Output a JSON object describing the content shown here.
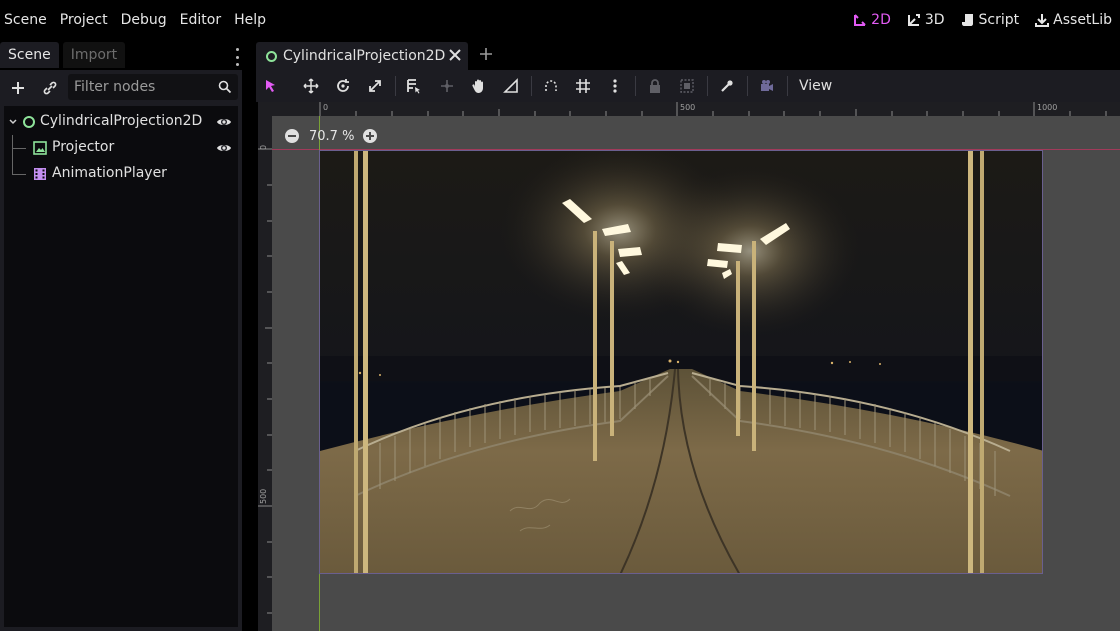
{
  "menu": [
    "Scene",
    "Project",
    "Debug",
    "Editor",
    "Help"
  ],
  "main_screens": [
    {
      "label": "2D",
      "icon": "2d-icon",
      "active": true
    },
    {
      "label": "3D",
      "icon": "3d-icon",
      "active": false
    },
    {
      "label": "Script",
      "icon": "script-icon",
      "active": false
    },
    {
      "label": "AssetLib",
      "icon": "assetlib-icon",
      "active": false
    }
  ],
  "dock": {
    "tabs": [
      "Scene",
      "Import"
    ],
    "filter_placeholder": "Filter nodes",
    "tree": [
      {
        "label": "CylindricalProjection2D",
        "icon": "node2d-icon",
        "visible_toggle": true
      },
      {
        "label": "Projector",
        "icon": "sprite2d-icon",
        "visible_toggle": true
      },
      {
        "label": "AnimationPlayer",
        "icon": "animationplayer-icon",
        "visible_toggle": false
      }
    ]
  },
  "editor_tab": {
    "title": "CylindricalProjection2D"
  },
  "toolbar": {
    "view_label": "View"
  },
  "viewport": {
    "zoom": "70.7 %",
    "ruler_top_labels": [
      "0",
      "500",
      "1000"
    ],
    "ruler_left_labels": [
      "0",
      "500"
    ]
  },
  "colors": {
    "accent": "#e35bf5",
    "node_green": "#8ee39a",
    "anim_purple": "#c38ef1",
    "guide_green": "#7aa236",
    "guide_red": "#a13a5a"
  }
}
